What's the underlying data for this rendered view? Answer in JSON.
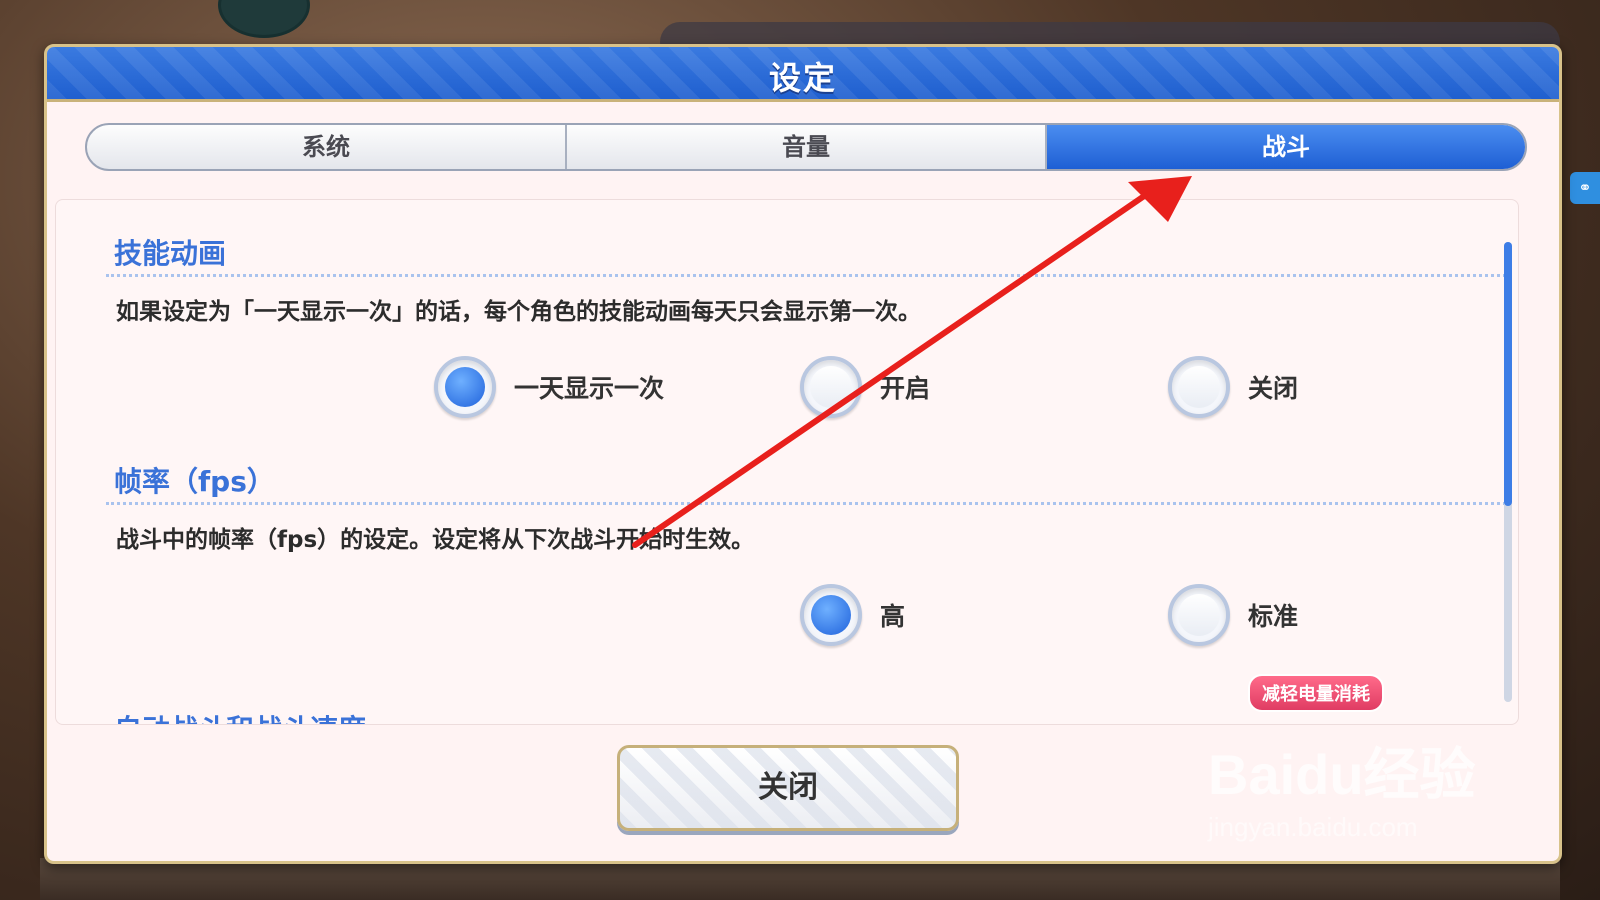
{
  "dialog": {
    "title": "设定",
    "tabs": [
      {
        "label": "系统",
        "active": false
      },
      {
        "label": "音量",
        "active": false
      },
      {
        "label": "战斗",
        "active": true
      }
    ],
    "close_button": "关闭"
  },
  "sections": {
    "skill_animation": {
      "title": "技能动画",
      "description": "如果设定为「一天显示一次」的话，每个角色的技能动画每天只会显示第一次。",
      "options": [
        {
          "label": "一天显示一次",
          "selected": true
        },
        {
          "label": "开启",
          "selected": false
        },
        {
          "label": "关闭",
          "selected": false
        }
      ]
    },
    "fps": {
      "title": "帧率（fps）",
      "description": "战斗中的帧率（fps）的设定。设定将从下次战斗开始时生效。",
      "options": [
        {
          "label": "高",
          "selected": true
        },
        {
          "label": "标准",
          "selected": false
        }
      ],
      "badge": "减轻电量消耗"
    },
    "next_section_title": "自动战斗和战斗速度"
  },
  "watermark": {
    "brand": "Baidu经验",
    "url": "jingyan.baidu.com"
  },
  "colors": {
    "header_blue": "#1f5fcf",
    "active_tab": "#1e5fd4",
    "section_title": "#3a72d8",
    "badge": "#e03c63",
    "annotation_arrow": "#e8201c"
  }
}
